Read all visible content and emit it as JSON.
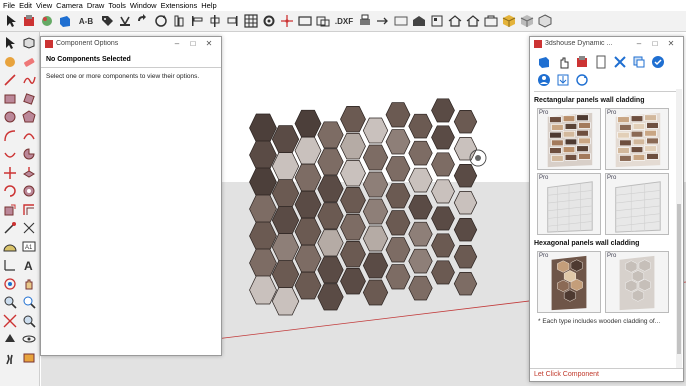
{
  "menubar": {
    "items": [
      "File",
      "Edit",
      "View",
      "Camera",
      "Draw",
      "Tools",
      "Window",
      "Extensions",
      "Help"
    ]
  },
  "toolbar": {
    "dim_label": "A-B",
    "dxf_label": ".DXF"
  },
  "component_options": {
    "title": "Component Options",
    "header": "No Components Selected",
    "message": "Select one or more components to view their options."
  },
  "dynamic_panel": {
    "title": "3dshouse Dynamic ...",
    "section1_title": "Rectangular panels wall cladding",
    "section2_title": "Hexagonal panels wall cladding",
    "pro_tag": "Pro",
    "note": "* Each type includes wooden cladding of...",
    "status": "Let Click Component"
  },
  "colors": {
    "accent_blue": "#1f6fd1",
    "hex_dark": "#5a4b45",
    "hex_light": "#c9c1bd",
    "status_red": "#c0392b"
  },
  "icons": {
    "select": "arrow-icon",
    "eraser": "eraser-icon"
  }
}
